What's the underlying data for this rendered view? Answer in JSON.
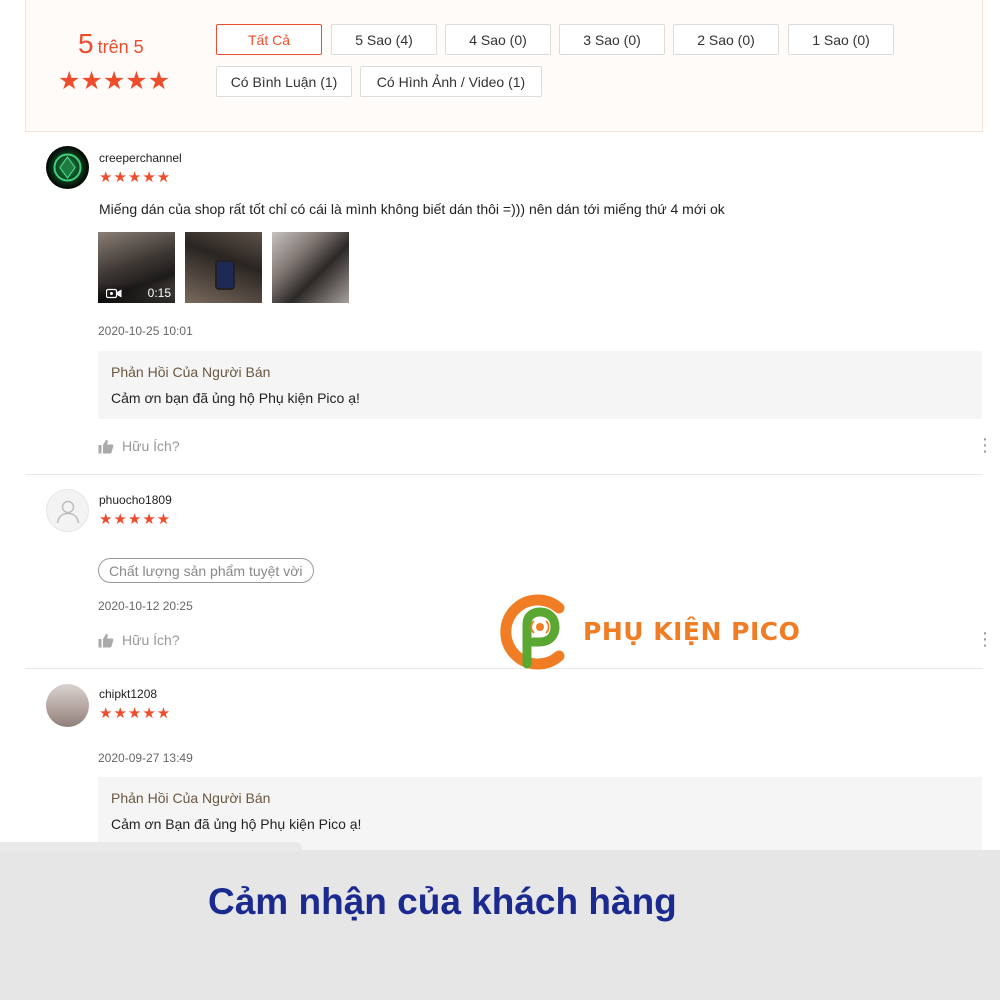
{
  "summary": {
    "score": "5",
    "score_suffix": "trên 5",
    "stars": "★★★★★",
    "filters": [
      {
        "label": "Tất Cả",
        "active": true
      },
      {
        "label": "5 Sao (4)"
      },
      {
        "label": "4 Sao (0)"
      },
      {
        "label": "3 Sao (0)"
      },
      {
        "label": "2 Sao (0)"
      },
      {
        "label": "1 Sao (0)"
      },
      {
        "label": "Có Bình Luận (1)"
      },
      {
        "label": "Có Hình Ảnh / Video (1)"
      }
    ]
  },
  "reviews": [
    {
      "username": "creeperchannel",
      "stars": "★★★★★",
      "comment": "Miếng dán của shop rất tốt chỉ có cái là mình không biết dán thôi =))) nên dán tới miếng thứ 4 mới ok",
      "video_duration": "0:15",
      "time": "2020-10-25 10:01",
      "reply_title": "Phản Hồi Của Người Bán",
      "reply_text": "Cảm ơn bạn đã ủng hộ Phụ kiện Pico ạ!",
      "helpful": "Hữu Ích?"
    },
    {
      "username": "phuocho1809",
      "stars": "★★★★★",
      "tag": "Chất lượng sản phẩm tuyệt vời",
      "time": "2020-10-12 20:25",
      "helpful": "Hữu Ích?"
    },
    {
      "username": "chipkt1208",
      "stars": "★★★★★",
      "time": "2020-09-27 13:49",
      "reply_title": "Phản Hồi Của Người Bán",
      "reply_text": "Cảm ơn Bạn đã ủng hộ Phụ kiện Pico ạ!"
    }
  ],
  "watermark": {
    "text": "PHỤ KIỆN PICO",
    "colors": {
      "orange": "#f07d24",
      "green": "#5aa832"
    }
  },
  "caption": "Cảm nhận của khách hàng",
  "colors": {
    "accent": "#ee4d2d",
    "caption": "#1b2a8f",
    "reply_title": "#6a5740"
  },
  "icons": [
    "star-icon",
    "avatar-placeholder-icon",
    "video-camera-icon",
    "thumbs-up-icon",
    "more-options-icon"
  ]
}
